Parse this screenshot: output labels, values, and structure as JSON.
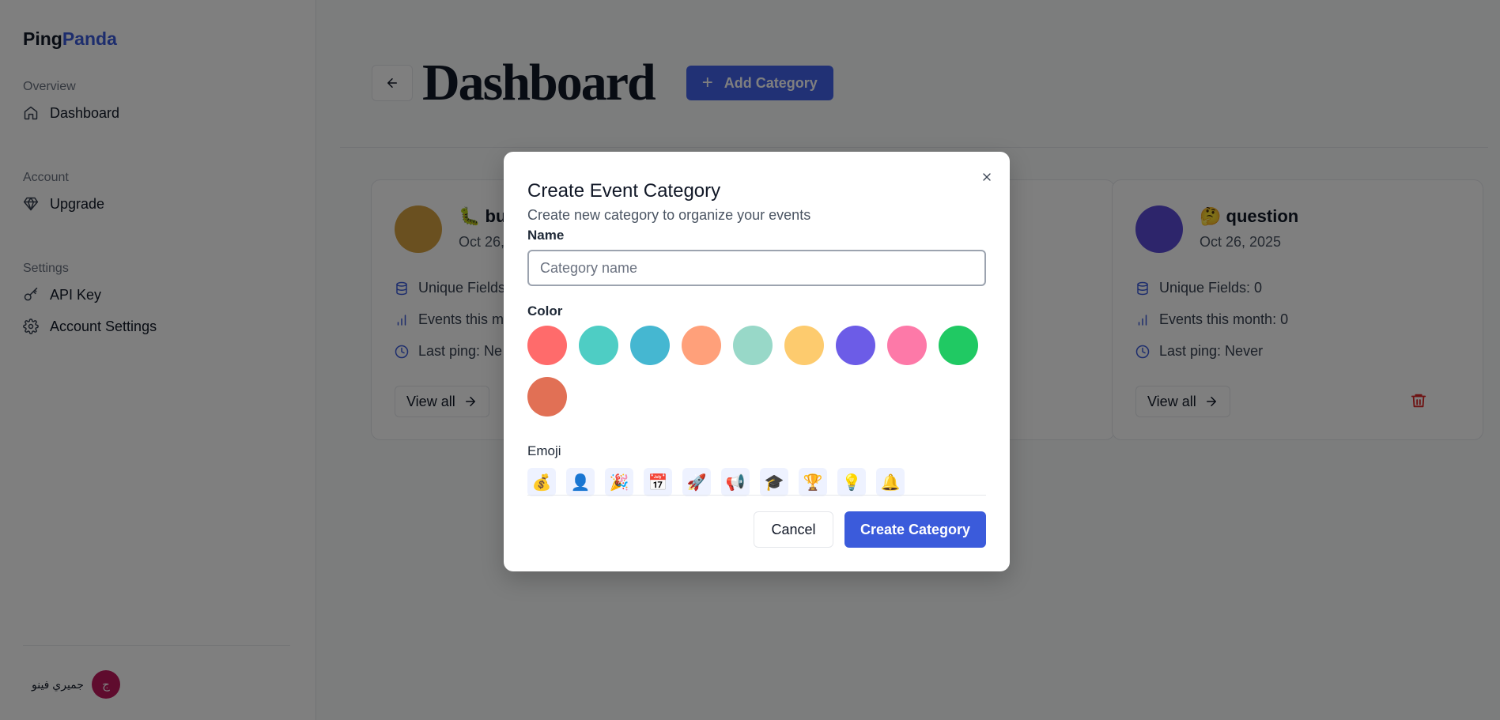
{
  "app": {
    "logo_part1": "Ping",
    "logo_part2": "Panda"
  },
  "sidebar": {
    "sections": [
      {
        "heading": "Overview",
        "items": [
          {
            "label": "Dashboard",
            "icon": "home-icon"
          }
        ]
      },
      {
        "heading": "Account",
        "items": [
          {
            "label": "Upgrade",
            "icon": "gem-icon"
          }
        ]
      },
      {
        "heading": "Settings",
        "items": [
          {
            "label": "API Key",
            "icon": "key-icon"
          },
          {
            "label": "Account Settings",
            "icon": "gear-icon"
          }
        ]
      }
    ],
    "user": {
      "name": "جمیري فینو",
      "avatar_letter": "ج",
      "avatar_color": "#be185d"
    }
  },
  "header": {
    "title": "Dashboard",
    "add_label": "Add Category"
  },
  "cards": [
    {
      "emoji": "🐛",
      "name": "bu",
      "date": "Oct 26,",
      "color": "#d4a040",
      "stats": {
        "fields": "Unique Fields",
        "events": "Events this m",
        "last_ping": "Last ping: Ne"
      },
      "view_all": "View all"
    },
    {
      "emoji": "",
      "name": "",
      "date": "",
      "color": "",
      "stats": {
        "fields": "",
        "events": "",
        "last_ping": ""
      },
      "view_all": ""
    },
    {
      "emoji": "🤔",
      "name": "question",
      "date": "Oct 26, 2025",
      "color": "#5b4bd6",
      "stats": {
        "fields": "Unique Fields: 0",
        "events": "Events this month: 0",
        "last_ping": "Last ping: Never"
      },
      "view_all": "View all"
    }
  ],
  "modal": {
    "title": "Create Event Category",
    "description": "Create new category to organize your events",
    "name_label": "Name",
    "name_placeholder": "Category name",
    "name_value": "",
    "color_label": "Color",
    "colors": [
      "#ff6b6b",
      "#4ecdc4",
      "#45b7d1",
      "#ffa07a",
      "#98d8c8",
      "#fdcb6e",
      "#6c5ce7",
      "#fd79a8",
      "#20c963",
      "#e17055"
    ],
    "emoji_label": "Emoji",
    "emojis": [
      "💰",
      "👤",
      "🎉",
      "📅",
      "🚀",
      "📢",
      "🎓",
      "🏆",
      "💡",
      "🔔"
    ],
    "cancel_label": "Cancel",
    "create_label": "Create Category"
  }
}
